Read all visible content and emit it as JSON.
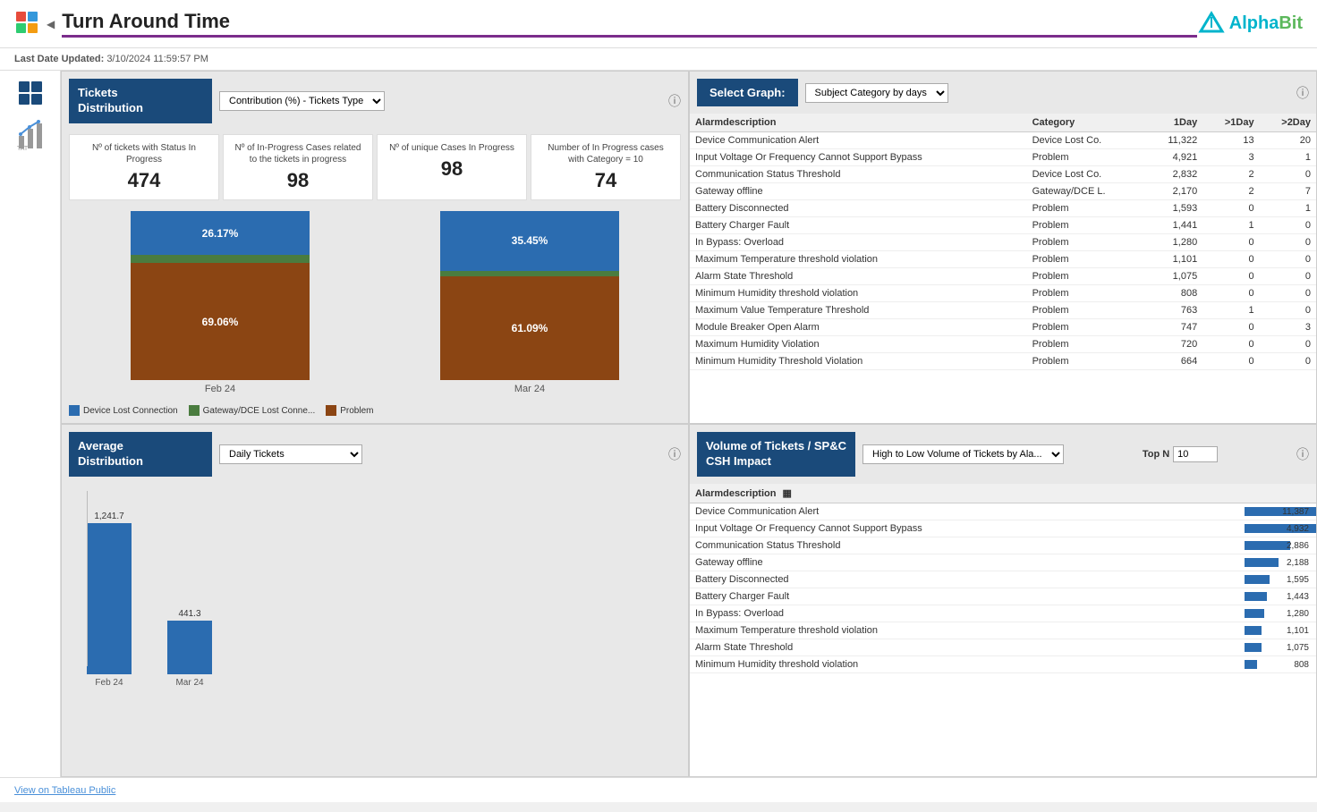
{
  "header": {
    "title": "Turn Around Time",
    "last_updated_label": "Last Date Updated:",
    "last_updated_value": "3/10/2024 11:59:57 PM",
    "brand": "AlphaBit"
  },
  "tickets_distribution": {
    "panel_title": "Tickets\nDistribution",
    "dropdown_selected": "Contribution (%) - Tickets Type",
    "dropdown_options": [
      "Contribution (%) - Tickets Type"
    ],
    "stats": [
      {
        "label": "Nº of tickets with Status In Progress",
        "value": "474"
      },
      {
        "label": "Nº of In-Progress Cases related to the tickets in progress",
        "value": "98"
      },
      {
        "label": "Nº of unique Cases In Progress",
        "value": "98"
      },
      {
        "label": "Number of In Progress cases with Category = 10",
        "value": "74"
      }
    ],
    "chart_feb": {
      "label": "Feb 24",
      "blue_pct": 26.17,
      "green_pct": 4.77,
      "brown_pct": 69.06,
      "blue_label": "26.17%",
      "brown_label": "69.06%"
    },
    "chart_mar": {
      "label": "Mar 24",
      "blue_pct": 35.45,
      "green_pct": 3.46,
      "brown_pct": 61.09,
      "blue_label": "35.45%",
      "brown_label": "61.09%"
    },
    "legend": [
      {
        "color": "#2b6cb0",
        "label": "Device Lost Connection"
      },
      {
        "color": "#4a7c3f",
        "label": "Gateway/DCE Lost Conne..."
      },
      {
        "color": "#8b4513",
        "label": "Problem"
      }
    ]
  },
  "select_graph": {
    "label": "Select Graph:",
    "dropdown_selected": "Subject Category by days",
    "dropdown_options": [
      "Subject Category by days"
    ],
    "table_headers": [
      "Alarmdescription",
      "Category",
      "1Day",
      ">1Day",
      ">2Day"
    ],
    "table_rows": [
      {
        "desc": "Device Communication Alert",
        "category": "Device Lost Co.",
        "d1": "11,322",
        "d1plus": "13",
        "d2plus": "20"
      },
      {
        "desc": "Input Voltage Or Frequency Cannot Support Bypass",
        "category": "Problem",
        "d1": "4,921",
        "d1plus": "3",
        "d2plus": "1"
      },
      {
        "desc": "Communication Status Threshold",
        "category": "Device Lost Co.",
        "d1": "2,832",
        "d1plus": "2",
        "d2plus": "0"
      },
      {
        "desc": "Gateway offline",
        "category": "Gateway/DCE L.",
        "d1": "2,170",
        "d1plus": "2",
        "d2plus": "7"
      },
      {
        "desc": "Battery Disconnected",
        "category": "Problem",
        "d1": "1,593",
        "d1plus": "0",
        "d2plus": "1"
      },
      {
        "desc": "Battery Charger Fault",
        "category": "Problem",
        "d1": "1,441",
        "d1plus": "1",
        "d2plus": "0"
      },
      {
        "desc": "In Bypass: Overload",
        "category": "Problem",
        "d1": "1,280",
        "d1plus": "0",
        "d2plus": "0"
      },
      {
        "desc": "Maximum Temperature threshold violation",
        "category": "Problem",
        "d1": "1,101",
        "d1plus": "0",
        "d2plus": "0"
      },
      {
        "desc": "Alarm State Threshold",
        "category": "Problem",
        "d1": "1,075",
        "d1plus": "0",
        "d2plus": "0"
      },
      {
        "desc": "Minimum Humidity threshold violation",
        "category": "Problem",
        "d1": "808",
        "d1plus": "0",
        "d2plus": "0"
      },
      {
        "desc": "Maximum Value Temperature Threshold",
        "category": "Problem",
        "d1": "763",
        "d1plus": "1",
        "d2plus": "0"
      },
      {
        "desc": "Module Breaker Open Alarm",
        "category": "Problem",
        "d1": "747",
        "d1plus": "0",
        "d2plus": "3"
      },
      {
        "desc": "Maximum Humidity Violation",
        "category": "Problem",
        "d1": "720",
        "d1plus": "0",
        "d2plus": "0"
      },
      {
        "desc": "Minimum Humidity Threshold Violation",
        "category": "Problem",
        "d1": "664",
        "d1plus": "0",
        "d2plus": "0"
      }
    ]
  },
  "average_distribution": {
    "panel_title": "Average\nDistribution",
    "dropdown_selected": "Daily Tickets",
    "dropdown_options": [
      "Daily Tickets"
    ],
    "bars": [
      {
        "label": "Feb 24",
        "value": 1241.7,
        "display": "1,241.7"
      },
      {
        "label": "Mar 24",
        "value": 441.3,
        "display": "441.3"
      }
    ],
    "max_value": 1400
  },
  "volume_tickets": {
    "panel_title": "Volume of Tickets / SP&C\nCSH Impact",
    "dropdown_selected": "High to Low Volume of Tickets by Ala...",
    "dropdown_options": [
      "High to Low Volume of Tickets by Ala..."
    ],
    "topn_label": "Top N",
    "topn_value": "10",
    "table_headers": [
      "Alarmdescription",
      ""
    ],
    "table_rows": [
      {
        "desc": "Device Communication Alert",
        "value": 11387
      },
      {
        "desc": "Input Voltage Or Frequency Cannot Support Bypass",
        "value": 4932
      },
      {
        "desc": "Communication Status Threshold",
        "value": 2886
      },
      {
        "desc": "Gateway offline",
        "value": 2188
      },
      {
        "desc": "Battery Disconnected",
        "value": 1595
      },
      {
        "desc": "Battery Charger Fault",
        "value": 1443
      },
      {
        "desc": "In Bypass: Overload",
        "value": 1280
      },
      {
        "desc": "Maximum Temperature threshold violation",
        "value": 1101
      },
      {
        "desc": "Alarm State Threshold",
        "value": 1075
      },
      {
        "desc": "Minimum Humidity threshold violation",
        "value": 808
      }
    ],
    "max_value": 11387
  },
  "footer": {
    "view_label": "View on Tableau Public"
  }
}
